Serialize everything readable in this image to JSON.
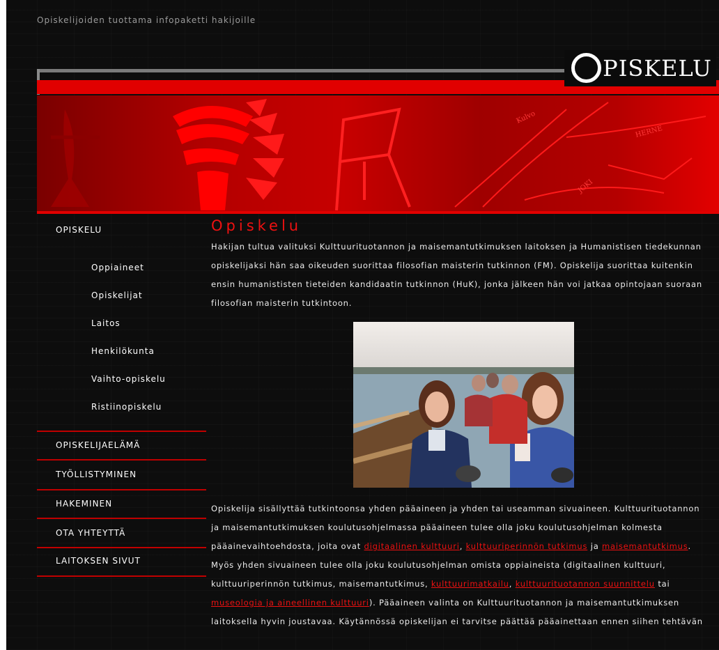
{
  "header": {
    "tagline": "Opiskelijoiden tuottama infopaketti hakijoille",
    "logo": "PISKELU"
  },
  "nav": {
    "top": "OPISKELU",
    "sub": [
      "Oppiaineet",
      "Opiskelijat",
      "Laitos",
      "Henkilökunta",
      "Vaihto-opiskelu",
      "Ristiinopiskelu"
    ],
    "sections": [
      "OPISKELIJAELÄMÄ",
      "TYÖLLISTYMINEN",
      "HAKEMINEN",
      "OTA YHTEYTTÄ",
      "LAITOKSEN SIVUT"
    ]
  },
  "content": {
    "title": "Opiskelu",
    "intro": "Hakijan tultua valituksi Kulttuurituotannon ja maisemantutkimuksen laitoksen ja Humanistisen tiedekunnan opiskelijaksi hän saa oikeuden suorittaa filosofian maisterin tutkinnon (FM). Opiskelija suorittaa kuitenkin ensin humanististen tieteiden kandidaatin tutkinnon (HuK), jonka jälkeen hän voi jatkaa opintojaan suoraan filosofian maisterin tutkintoon.",
    "body_1": "Opiskelija sisällyttää tutkintoonsa yhden pääaineen ja yhden tai useamman sivuaineen. Kulttuurituotannon ja maisemantutkimuksen koulutusohjelmassa pääaineen tulee olla joku koulutusohjelman kolmesta pääainevaihtoehdosta, joita ovat ",
    "link_1": "digitaalinen kulttuuri",
    "sep_1": ", ",
    "link_2": "kulttuuriperinnön tutkimus",
    "sep_2": " ja ",
    "link_3": "maisemantutkimus",
    "body_2": ". Myös yhden sivuaineen tulee olla joku koulutusohjelman omista oppiaineista (digitaalinen kulttuuri, kulttuuriperinnön tutkimus, maisemantutkimus, ",
    "link_4": "kulttuurimatkailu",
    "sep_3": ", ",
    "link_5": "kulttuurituotannon suunnittelu",
    "sep_4": " tai ",
    "link_6": "museologia ja aineellinen kulttuuri",
    "body_3": "). Pääaineen valinta on Kulttuurituotannon ja maisemantutkimuksen laitoksella hyvin joustavaa. Käytännössä opiskelijan ei tarvitse päättää pääainettaan ennen siihen tehtävän"
  }
}
